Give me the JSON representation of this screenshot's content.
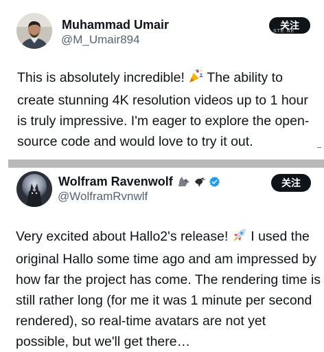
{
  "posts": [
    {
      "name": "Muhammad Umair",
      "handle": "@M_Umair894",
      "follow_label": "关注",
      "watermark": "STE NE",
      "text_before": "This is absolutely incredible! ",
      "text_emoji": "party-popper-icon",
      "text_after": "  The ability to create stunning 4K resolution videos up to 1 hour is truly impressive. I'm eager to explore the open-source code and would love to try it out."
    },
    {
      "name": "Wolfram Ravenwolf",
      "handle": "@WolframRvnwlf",
      "follow_label": "关注",
      "name_badges": [
        "wolf-emoji-icon",
        "raven-emoji-icon",
        "verified-badge-icon"
      ],
      "text_before": "Very excited about Hallo2's release! ",
      "text_emoji": "rocket-icon",
      "text_after": " I used the original Hallo some time ago and am impressed by how far the project has come. The rendering time is still rather long (for me it was 1 minute per second rendered), so real-time avatars are not yet possible, but we'll get there…"
    }
  ],
  "colors": {
    "text": "#0f1419",
    "secondary": "#536471",
    "follow_bg": "#0f1419",
    "verified": "#1d9bf0",
    "divider": "#b9b9b9"
  }
}
